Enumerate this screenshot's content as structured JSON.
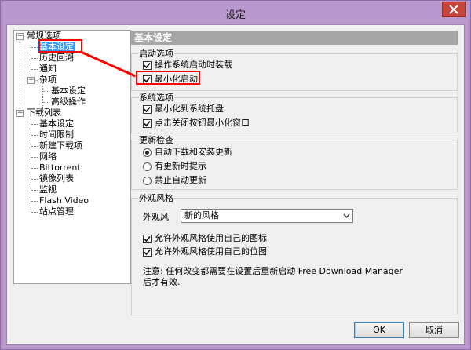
{
  "window": {
    "title": "设定",
    "accent_color": "#c7463a",
    "frame_color": "#b998ce"
  },
  "tree": {
    "general": {
      "label": "常规选项",
      "expanded": true,
      "children": {
        "basic": "基本设定",
        "history": "历史回溯",
        "notify": "通知",
        "misc": {
          "label": "杂项",
          "expanded": true,
          "children": {
            "basic": "基本设定",
            "advanced": "高级操作"
          }
        }
      }
    },
    "downloads": {
      "label": "下载列表",
      "expanded": true,
      "children": {
        "basic": "基本设定",
        "time_limit": "时间限制",
        "new_download": "新建下载项",
        "network": "网络",
        "bittorrent": "Bittorrent",
        "mirror": "镜像列表",
        "monitor": "监视",
        "flash": "Flash Video",
        "site": "站点管理"
      }
    }
  },
  "panel": {
    "header": "基本设定",
    "startup": {
      "title": "启动选项",
      "load_on_startup": {
        "label": "操作系统启动时装载",
        "checked": true
      },
      "minimized": {
        "label": "最小化启动",
        "checked": true
      }
    },
    "system": {
      "title": "系统选项",
      "tray": {
        "label": "最小化到系统托盘",
        "checked": true
      },
      "close_minimize": {
        "label": "点击关闭按钮最小化窗口",
        "checked": true
      }
    },
    "update": {
      "title": "更新检查",
      "auto": {
        "label": "自动下载和安装更新",
        "selected": true
      },
      "notify": {
        "label": "有更新时提示",
        "selected": false
      },
      "disable": {
        "label": "禁止自动更新",
        "selected": false
      }
    },
    "skin": {
      "title": "外观风格",
      "skin_label": "外观风",
      "skin_value": "新的风格",
      "own_icons": {
        "label": "允许外观风格使用自己的图标",
        "checked": true
      },
      "own_bitmaps": {
        "label": "允许外观风格使用自己的位图",
        "checked": true
      },
      "note": "注意: 任何改变都需要在设置后重新启动 Free Download Manager后才有效."
    }
  },
  "buttons": {
    "ok": "OK",
    "cancel": "取消"
  }
}
